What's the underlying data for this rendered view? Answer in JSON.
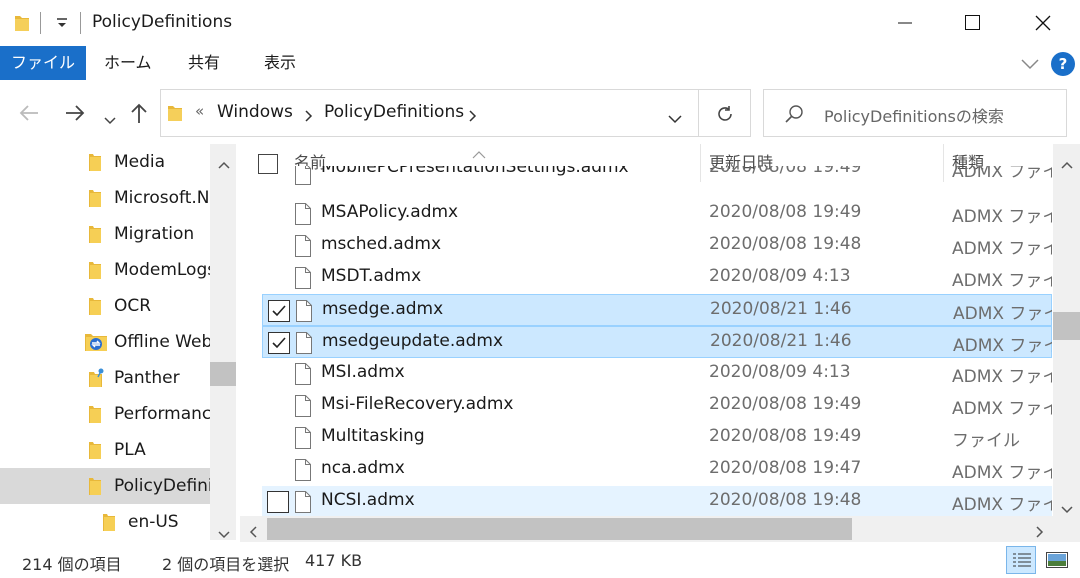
{
  "window": {
    "title": "PolicyDefinitions",
    "accent": "#1a6fc9",
    "selection_color": "#cce8ff"
  },
  "ribbon": {
    "tabs": [
      "ファイル",
      "ホーム",
      "共有",
      "表示"
    ]
  },
  "nav": {
    "breadcrumb_sep": "«",
    "breadcrumb": [
      "Windows",
      "PolicyDefinitions"
    ],
    "search_placeholder": "PolicyDefinitionsの検索"
  },
  "tree": [
    {
      "label": "Media",
      "icon": "folder-icon"
    },
    {
      "label": "Microsoft.NET",
      "icon": "folder-icon"
    },
    {
      "label": "Migration",
      "icon": "folder-icon"
    },
    {
      "label": "ModemLogs",
      "icon": "folder-icon"
    },
    {
      "label": "OCR",
      "icon": "folder-icon"
    },
    {
      "label": "Offline Web Pages",
      "icon": "offline-folder-icon"
    },
    {
      "label": "Panther",
      "icon": "panther-folder-icon"
    },
    {
      "label": "Performance",
      "icon": "folder-icon"
    },
    {
      "label": "PLA",
      "icon": "folder-icon"
    },
    {
      "label": "PolicyDefinitions",
      "icon": "folder-icon",
      "selected": true
    },
    {
      "label": "en-US",
      "icon": "folder-icon"
    }
  ],
  "columns": {
    "name": "名前",
    "date": "更新日時",
    "type": "種類"
  },
  "files": [
    {
      "name": "MobilePCPresentationSettings.admx",
      "date": "2020/08/08 19:49",
      "type": "ADMX ファイル",
      "partial": true
    },
    {
      "name": "MSAPolicy.admx",
      "date": "2020/08/08 19:49",
      "type": "ADMX ファイル"
    },
    {
      "name": "msched.admx",
      "date": "2020/08/08 19:48",
      "type": "ADMX ファイル"
    },
    {
      "name": "MSDT.admx",
      "date": "2020/08/09 4:13",
      "type": "ADMX ファイル"
    },
    {
      "name": "msedge.admx",
      "date": "2020/08/21 1:46",
      "type": "ADMX ファイル",
      "checked": true
    },
    {
      "name": "msedgeupdate.admx",
      "date": "2020/08/21 1:46",
      "type": "ADMX ファイル",
      "checked": true
    },
    {
      "name": "MSI.admx",
      "date": "2020/08/09 4:13",
      "type": "ADMX ファイル"
    },
    {
      "name": "Msi-FileRecovery.admx",
      "date": "2020/08/08 19:49",
      "type": "ADMX ファイル"
    },
    {
      "name": "Multitasking",
      "date": "2020/08/08 19:49",
      "type": "ファイル"
    },
    {
      "name": "nca.admx",
      "date": "2020/08/08 19:47",
      "type": "ADMX ファイル"
    },
    {
      "name": "NCSI.admx",
      "date": "2020/08/08 19:48",
      "type": "ADMX ファイル",
      "hover": true
    }
  ],
  "status": {
    "count": "214 個の項目",
    "selected": "2 個の項目を選択",
    "size": "417 KB"
  }
}
